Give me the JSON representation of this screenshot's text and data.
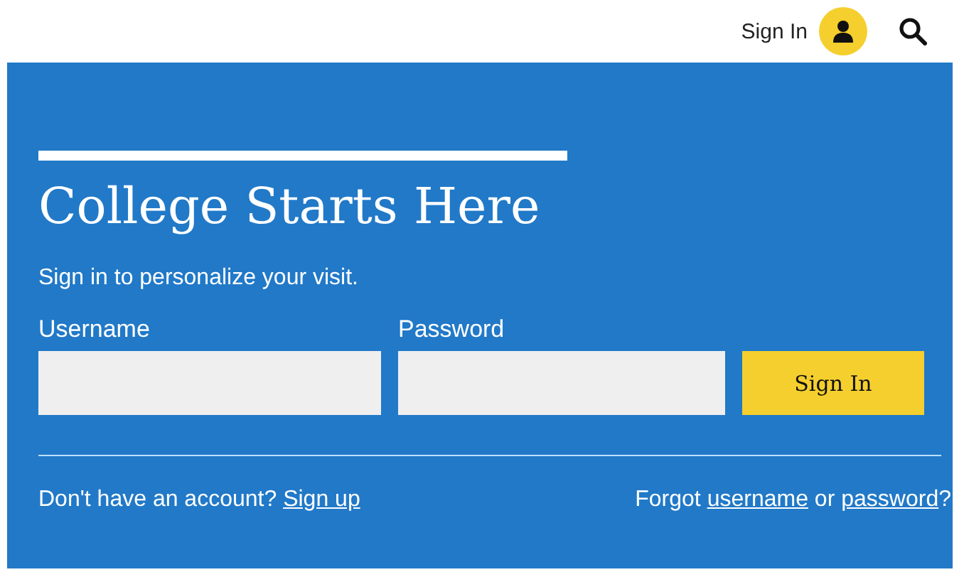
{
  "header": {
    "sign_in_label": "Sign In"
  },
  "panel": {
    "title": "College Starts Here",
    "subtitle": "Sign in to personalize your visit.",
    "fields": [
      {
        "label": "Username"
      },
      {
        "label": "Password"
      }
    ],
    "submit": "Sign In",
    "footer_left": [
      {
        "kind": "text",
        "text": "Don't have an account?"
      },
      {
        "kind": "link",
        "text": "Sign up"
      }
    ],
    "footer_right": [
      {
        "kind": "text",
        "text": "Forgot"
      },
      {
        "kind": "link",
        "text": "username"
      },
      {
        "kind": "text",
        "text": "or"
      },
      {
        "kind": "link",
        "text": "password"
      },
      {
        "kind": "text",
        "text": "?"
      }
    ]
  }
}
